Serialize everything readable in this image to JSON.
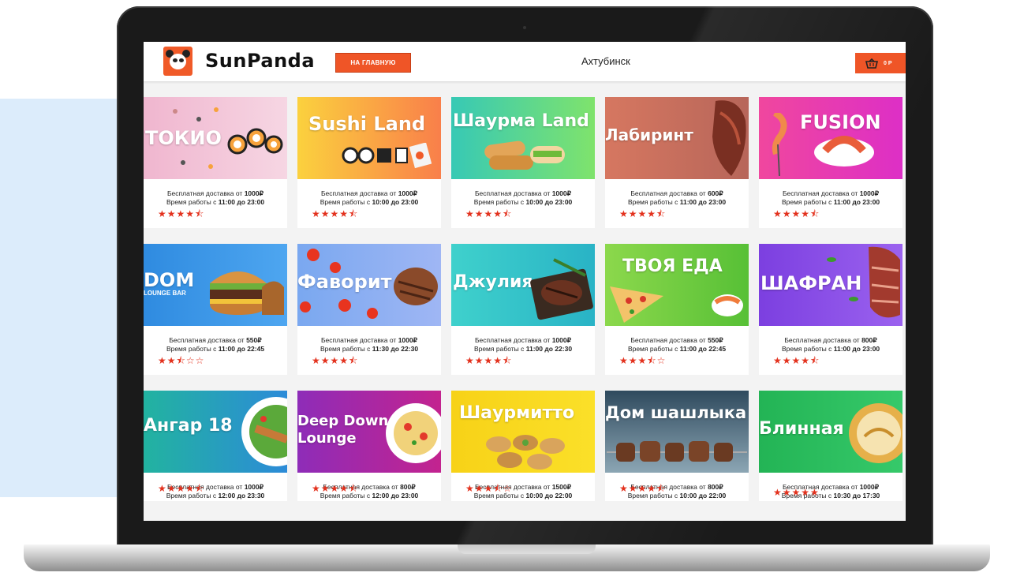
{
  "header": {
    "brand": "SunPanda",
    "home_button": "НА ГЛАВНУЮ",
    "city": "Ахтубинск",
    "cart_count": "0 Р"
  },
  "colors": {
    "accent": "#ef5527",
    "star": "#e3311d"
  },
  "restaurants": [
    {
      "name": "ТОКИО",
      "sub": "",
      "delivery": "Бесплатная доставка от ",
      "min": "1000₽",
      "hours_prefix": "Время работы с ",
      "hours": "11:00 до 23:00",
      "stars": "★★★★⯪",
      "rating": 4.5
    },
    {
      "name": "Sushi Land",
      "sub": "",
      "delivery": "Бесплатная доставка от ",
      "min": "1000₽",
      "hours_prefix": "Время работы с ",
      "hours": "10:00 до 23:00",
      "stars": "★★★★⯪",
      "rating": 4.5
    },
    {
      "name": "Шаурма Land",
      "sub": "",
      "delivery": "Бесплатная доставка от ",
      "min": "1000₽",
      "hours_prefix": "Время работы с ",
      "hours": "10:00 до 23:00",
      "stars": "★★★★⯪",
      "rating": 4.5
    },
    {
      "name": "Лабиринт",
      "sub": "",
      "delivery": "Бесплатная доставка от ",
      "min": "600₽",
      "hours_prefix": "Время работы с ",
      "hours": "11:00 до 23:00",
      "stars": "★★★★⯪",
      "rating": 4.5
    },
    {
      "name": "FUSION",
      "sub": "",
      "delivery": "Бесплатная доставка от ",
      "min": "1000₽",
      "hours_prefix": "Время работы с ",
      "hours": "11:00 до 23:00",
      "stars": "★★★★⯪",
      "rating": 4.5
    },
    {
      "name": "DOM",
      "sub": "LOUNGE BAR",
      "delivery": "Бесплатная доставка от ",
      "min": "550₽",
      "hours_prefix": "Время работы с ",
      "hours": "11:00 до 22:45",
      "stars": "★★⯪☆☆",
      "rating": 2.5
    },
    {
      "name": "Фаворит",
      "sub": "",
      "delivery": "Бесплатная доставка от ",
      "min": "1000₽",
      "hours_prefix": "Время работы с ",
      "hours": "11:30 до 22:30",
      "stars": "★★★★⯪",
      "rating": 4.5
    },
    {
      "name": "Джулия",
      "sub": "",
      "delivery": "Бесплатная доставка от ",
      "min": "1000₽",
      "hours_prefix": "Время работы с ",
      "hours": "11:00 до 22:30",
      "stars": "★★★★⯪",
      "rating": 4.5
    },
    {
      "name": "ТВОЯ ЕДА",
      "sub": "",
      "delivery": "Бесплатная доставка от ",
      "min": "550₽",
      "hours_prefix": "Время работы с ",
      "hours": "11:00 до 22:45",
      "stars": "★★★⯪☆",
      "rating": 3.5
    },
    {
      "name": "ШАФРАН",
      "sub": "",
      "delivery": "Бесплатная доставка от ",
      "min": "800₽",
      "hours_prefix": "Время работы с ",
      "hours": "11:00 до 23:00",
      "stars": "★★★★⯪",
      "rating": 4.5
    },
    {
      "name": "Ангар 18",
      "sub": "",
      "delivery": "Бесплатная доставка от ",
      "min": "1000₽",
      "hours_prefix": "Время работы с ",
      "hours": "12:00 до 23:30",
      "stars": "★★★★⯪",
      "rating": 4.5
    },
    {
      "name": "Deep Down",
      "sub": "Lounge",
      "delivery": "Бесплатная доставка от ",
      "min": "800₽",
      "hours_prefix": "Время работы с ",
      "hours": "12:00 до 23:00",
      "stars": "★★★★⯪",
      "rating": 4.5
    },
    {
      "name": "Шаурмитто",
      "sub": "",
      "delivery": "Бесплатная доставка от ",
      "min": "1500₽",
      "hours_prefix": "Время работы с ",
      "hours": "10:00 до 22:00",
      "stars": "★★★⯪☆",
      "rating": 3.5
    },
    {
      "name": "Дом шашлыка",
      "sub": "",
      "delivery": "Бесплатная доставка от ",
      "min": "800₽",
      "hours_prefix": "Время работы с ",
      "hours": "10:00 до 22:00",
      "stars": "★★★★⯪",
      "rating": 4.5
    },
    {
      "name": "Блинная",
      "sub": "",
      "delivery": "Бесплатная доставка от ",
      "min": "1000₽",
      "hours_prefix": "Время работы с ",
      "hours": "10:30 до 17:30",
      "stars": "★★★★★",
      "rating": 5
    }
  ]
}
